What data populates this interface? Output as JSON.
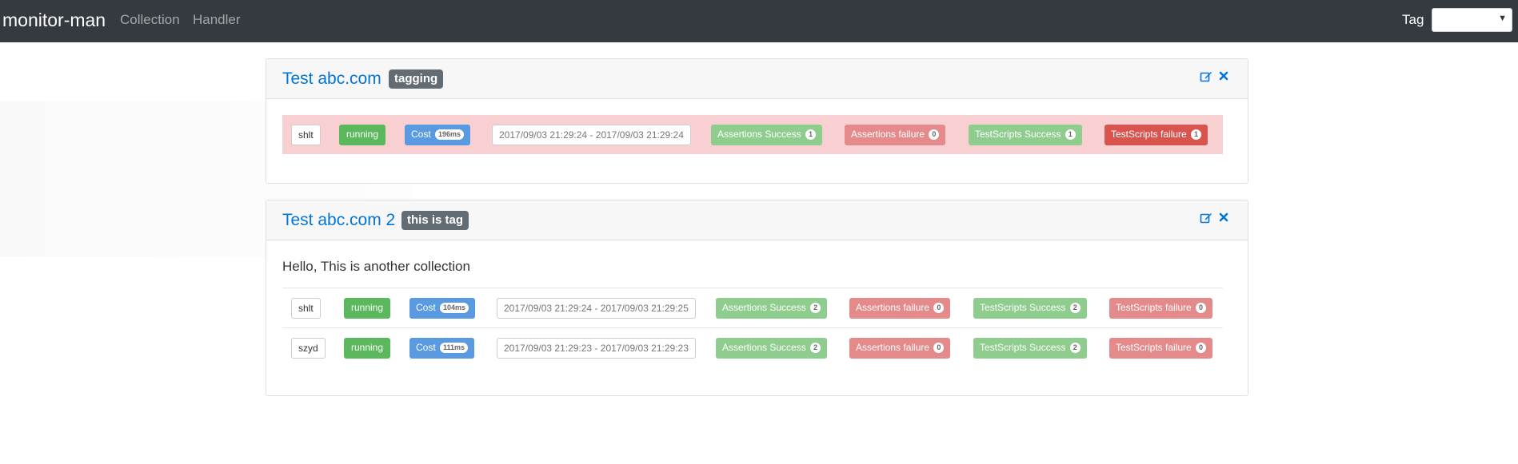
{
  "navbar": {
    "brand": "monitor-man",
    "links": [
      "Collection",
      "Handler"
    ],
    "tag_label": "Tag",
    "tag_value": ""
  },
  "collections": [
    {
      "title": "Test abc.com",
      "tag": "tagging",
      "description": "",
      "results": [
        {
          "name": "shlt",
          "status": "running",
          "cost_label": "Cost",
          "cost": "196ms",
          "range": "2017/09/03 21:29:24 - 2017/09/03 21:29:24",
          "assert_ok_label": "Assertions Success",
          "assert_ok": "1",
          "assert_fail_label": "Assertions failure",
          "assert_fail": "0",
          "ts_ok_label": "TestScripts Success",
          "ts_ok": "1",
          "ts_fail_label": "TestScripts failure",
          "ts_fail": "1",
          "failed": true
        }
      ]
    },
    {
      "title": "Test abc.com 2",
      "tag": "this is tag",
      "description": "Hello, This is another collection",
      "results": [
        {
          "name": "shlt",
          "status": "running",
          "cost_label": "Cost",
          "cost": "104ms",
          "range": "2017/09/03 21:29:24 - 2017/09/03 21:29:25",
          "assert_ok_label": "Assertions Success",
          "assert_ok": "2",
          "assert_fail_label": "Assertions failure",
          "assert_fail": "0",
          "ts_ok_label": "TestScripts Success",
          "ts_ok": "2",
          "ts_fail_label": "TestScripts failure",
          "ts_fail": "0",
          "failed": false
        },
        {
          "name": "szyd",
          "status": "running",
          "cost_label": "Cost",
          "cost": "111ms",
          "range": "2017/09/03 21:29:23 - 2017/09/03 21:29:23",
          "assert_ok_label": "Assertions Success",
          "assert_ok": "2",
          "assert_fail_label": "Assertions failure",
          "assert_fail": "0",
          "ts_ok_label": "TestScripts Success",
          "ts_ok": "2",
          "ts_fail_label": "TestScripts failure",
          "ts_fail": "0",
          "failed": false
        }
      ]
    }
  ],
  "icons": {
    "edit": "edit-icon",
    "close": "close-icon",
    "dropdown": "chevron-down-icon"
  },
  "colors": {
    "navbar": "#343a40",
    "link": "#0275d8",
    "success": "#5cb85c",
    "danger": "#d9534f",
    "danger_row": "#f8d0d1"
  }
}
